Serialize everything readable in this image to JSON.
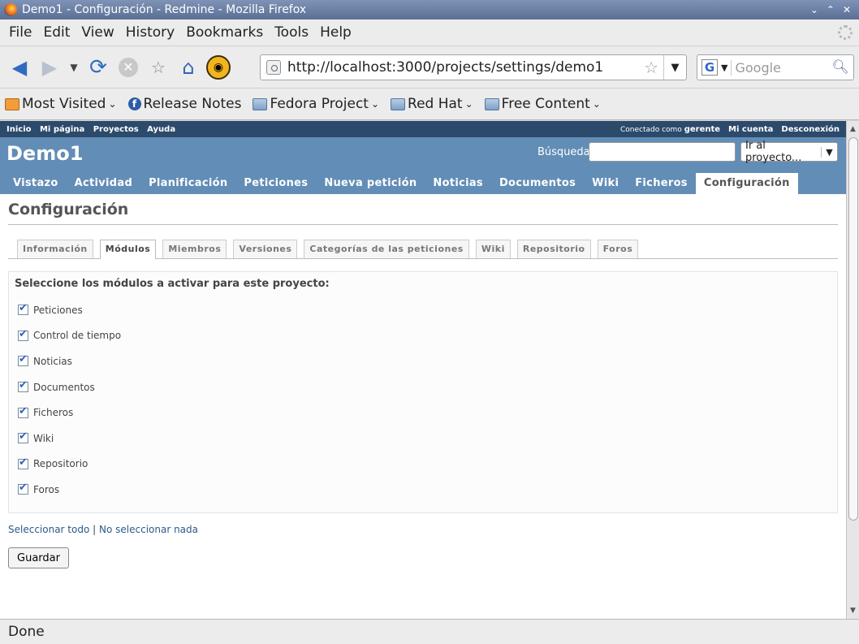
{
  "window": {
    "title": "Demo1 - Configuración - Redmine - Mozilla Firefox",
    "minimize": "⌄",
    "maximize": "⌃",
    "close": "✕"
  },
  "menu": [
    "File",
    "Edit",
    "View",
    "History",
    "Bookmarks",
    "Tools",
    "Help"
  ],
  "nav": {
    "url": "http://localhost:3000/projects/settings/demo1",
    "search_placeholder": "Google"
  },
  "bookmarks": [
    {
      "label": "Most Visited",
      "icon": "rss-icon",
      "dropdown": true
    },
    {
      "label": "Release Notes",
      "icon": "fedora-icon",
      "dropdown": false
    },
    {
      "label": "Fedora Project",
      "icon": "folder-icon",
      "dropdown": true
    },
    {
      "label": "Red Hat",
      "icon": "folder-icon",
      "dropdown": true
    },
    {
      "label": "Free Content",
      "icon": "folder-icon",
      "dropdown": true
    }
  ],
  "top_menu": {
    "left": [
      "Inicio",
      "Mi página",
      "Proyectos",
      "Ayuda"
    ],
    "logged_as": "Conectado como",
    "user": "gerente",
    "my_account": "Mi cuenta",
    "logout": "Desconexión"
  },
  "header": {
    "project": "Demo1",
    "search_label": "Búsqueda:",
    "jump": "Ir al proyecto..."
  },
  "main_tabs": [
    "Vistazo",
    "Actividad",
    "Planificación",
    "Peticiones",
    "Nueva petición",
    "Noticias",
    "Documentos",
    "Wiki",
    "Ficheros",
    "Configuración"
  ],
  "active_main_tab": 9,
  "page_title": "Configuración",
  "sub_tabs": [
    "Información",
    "Módulos",
    "Miembros",
    "Versiones",
    "Categorías de las peticiones",
    "Wiki",
    "Repositorio",
    "Foros"
  ],
  "active_sub_tab": 1,
  "modules": {
    "heading": "Seleccione los módulos a activar para este proyecto:",
    "items": [
      {
        "label": "Peticiones",
        "checked": true
      },
      {
        "label": "Control de tiempo",
        "checked": true
      },
      {
        "label": "Noticias",
        "checked": true
      },
      {
        "label": "Documentos",
        "checked": true
      },
      {
        "label": "Ficheros",
        "checked": true
      },
      {
        "label": "Wiki",
        "checked": true
      },
      {
        "label": "Repositorio",
        "checked": true
      },
      {
        "label": "Foros",
        "checked": true
      }
    ]
  },
  "links": {
    "select_all": "Seleccionar todo",
    "separator": "|",
    "select_none": "No seleccionar nada"
  },
  "save_label": "Guardar",
  "status": "Done",
  "colors": {
    "header_blue": "#628db6",
    "top_menu": "#2c4a6b",
    "link": "#2a5a8a"
  }
}
